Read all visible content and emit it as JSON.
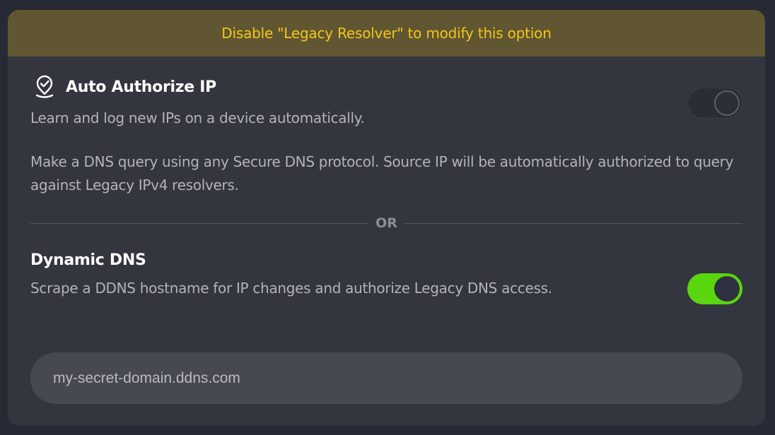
{
  "banner": {
    "text": "Disable \"Legacy Resolver\" to modify this option"
  },
  "auto_authorize": {
    "title": "Auto Authorize IP",
    "subtitle": "Learn and log new IPs on a device automatically.",
    "description": "Make a DNS query using any Secure DNS protocol. Source IP will be automatically authorized to query against Legacy IPv4 resolvers.",
    "toggle_state": "off",
    "icon": "location-check-icon"
  },
  "divider": {
    "label": "OR"
  },
  "dynamic_dns": {
    "title": "Dynamic DNS",
    "description": "Scrape a DDNS hostname for IP changes and authorize Legacy DNS access.",
    "toggle_state": "on",
    "hostname_value": "my-secret-domain.ddns.com"
  },
  "colors": {
    "banner_bg": "#615632",
    "banner_text": "#f2c719",
    "toggle_on": "#5ad60f",
    "card_bg": "#33353f"
  }
}
